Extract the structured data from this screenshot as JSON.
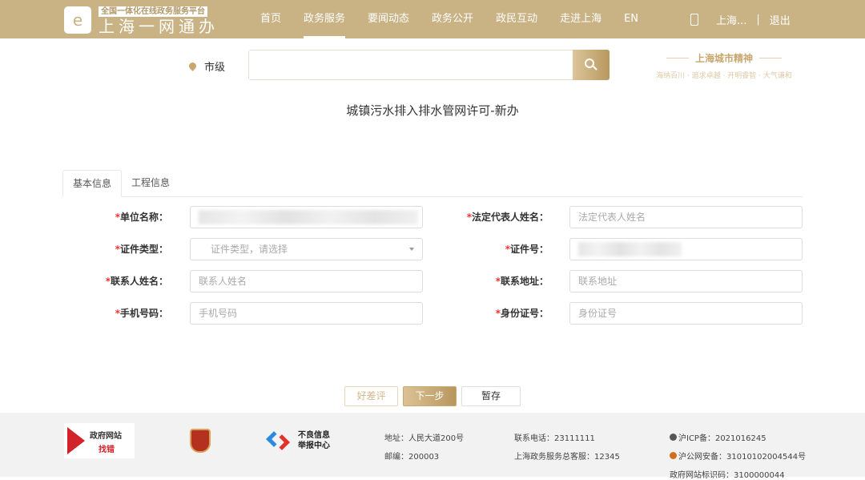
{
  "header": {
    "logo_sub": "全国一体化在线政务服务平台",
    "logo_main": "上海一网通办",
    "nav": [
      "首页",
      "政务服务",
      "要闻动态",
      "政务公开",
      "政民互动",
      "走进上海",
      "EN"
    ],
    "user": "上海...",
    "sep": "|",
    "logout": "退出"
  },
  "search": {
    "location": "市级",
    "placeholder": ""
  },
  "spirit": {
    "title": "上海城市精神",
    "slogan": "海纳百川 · 追求卓越 · 开明睿智 · 大气谦和"
  },
  "page_title": "城镇污水排入排水管网许可-新办",
  "tabs": [
    "基本信息",
    "工程信息"
  ],
  "form": {
    "req": "*",
    "left": [
      {
        "label": "单位名称：",
        "placeholder": ""
      },
      {
        "label": "证件类型：",
        "placeholder": "证件类型，请选择"
      },
      {
        "label": "联系人姓名：",
        "placeholder": "联系人姓名"
      },
      {
        "label": "手机号码：",
        "placeholder": "手机号码"
      }
    ],
    "right": [
      {
        "label": "法定代表人姓名：",
        "placeholder": "法定代表人姓名"
      },
      {
        "label": "证件号：",
        "placeholder": ""
      },
      {
        "label": "联系地址：",
        "placeholder": "联系地址"
      },
      {
        "label": "身份证号：",
        "placeholder": "身份证号"
      }
    ]
  },
  "buttons": {
    "rate": "好差评",
    "next": "下一步",
    "save": "暂存"
  },
  "footer": {
    "find_error_1": "政府网站",
    "find_error_2": "找错",
    "report_1": "不良信息",
    "report_2": "举报中心",
    "address": "地址：人民大道200号",
    "postcode": "邮编：200003",
    "phone": "联系电话：23111111",
    "hotline": "上海政务服务总客服：12345",
    "icp": "沪ICP备：2021016245",
    "police": "沪公网安备：31010102004544号",
    "site_code": "政府网站标识码：3100000044"
  }
}
